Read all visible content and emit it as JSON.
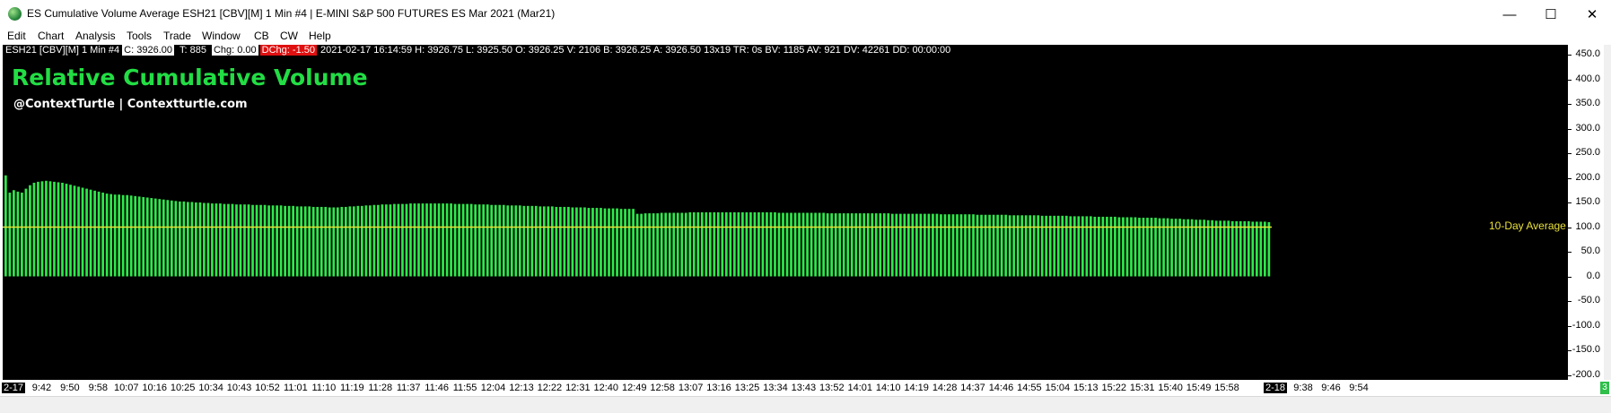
{
  "window": {
    "title": "ES Cumulative Volume Average ESH21 [CBV][M]  1 Min   #4 | E-MINI S&P 500 FUTURES ES Mar 2021 (Mar21)",
    "minimize_glyph": "—",
    "maximize_glyph": "☐",
    "close_glyph": "✕",
    "icon": "globe-icon"
  },
  "menu": [
    "Edit",
    "Chart",
    "Analysis",
    "Tools",
    "Trade",
    "Window",
    "CB",
    "CW",
    "Help"
  ],
  "info_bar": {
    "symbol": "ESH21 [CBV][M]  1 Min   #4",
    "close": "C: 3926.00",
    "ticks": "T: 885",
    "chg": "Chg: 0.00",
    "dchg": "DChg: -1.50",
    "rest": "2021-02-17 16:14:59 H: 3926.75 L: 3925.50 O: 3926.25 V: 2106 B: 3926.25 A: 3926.50 13x19 TR: 0s BV: 1185 AV: 921 DV: 42261 DD: 00:00:00"
  },
  "chart": {
    "title": "Relative Cumulative Volume",
    "subtitle": "@ContextTurtle | Contextturtle.com",
    "average_label": "10-Day Average",
    "colors": {
      "background": "#000000",
      "bars": "#2ee84a",
      "average_line": "#e8e03a",
      "title": "#22dd44",
      "dchg_bg": "#e01010"
    }
  },
  "chart_data": {
    "type": "bar",
    "title": "Relative Cumulative Volume",
    "y_ticks": [
      "450.0",
      "400.0",
      "350.0",
      "300.0",
      "250.0",
      "200.0",
      "150.0",
      "100.0",
      "50.0",
      "0.0",
      "-50.0",
      "-100.0",
      "-150.0",
      "-200.0"
    ],
    "ylim": [
      -210,
      470
    ],
    "x_labels": [
      "2-17",
      "9:42",
      "9:50",
      "9:58",
      "10:07",
      "10:16",
      "10:25",
      "10:34",
      "10:43",
      "10:52",
      "11:01",
      "11:10",
      "11:19",
      "11:28",
      "11:37",
      "11:46",
      "11:55",
      "12:04",
      "12:13",
      "12:22",
      "12:31",
      "12:40",
      "12:49",
      "12:58",
      "13:07",
      "13:16",
      "13:25",
      "13:34",
      "13:43",
      "13:52",
      "14:01",
      "14:10",
      "14:19",
      "14:28",
      "14:37",
      "14:46",
      "14:55",
      "15:04",
      "15:13",
      "15:22",
      "15:31",
      "15:40",
      "15:49",
      "15:58",
      "2-18",
      "9:38",
      "9:46",
      "9:54"
    ],
    "x_labels_highlighted": [
      "2-17",
      "2-18"
    ],
    "series": [
      {
        "name": "Relative Cumulative Volume",
        "values": [
          205,
          170,
          175,
          172,
          170,
          178,
          185,
          190,
          192,
          193,
          194,
          193,
          192,
          191,
          190,
          188,
          186,
          184,
          182,
          180,
          178,
          176,
          174,
          172,
          170,
          168,
          167,
          166,
          166,
          165,
          165,
          164,
          163,
          162,
          161,
          160,
          159,
          158,
          157,
          156,
          155,
          154,
          153,
          152,
          152,
          151,
          151,
          150,
          150,
          149,
          149,
          148,
          148,
          148,
          147,
          147,
          147,
          146,
          146,
          146,
          146,
          145,
          145,
          145,
          145,
          144,
          144,
          144,
          144,
          143,
          143,
          143,
          142,
          142,
          142,
          142,
          141,
          141,
          141,
          141,
          140,
          140,
          140,
          141,
          141,
          142,
          142,
          143,
          143,
          144,
          144,
          145,
          145,
          146,
          146,
          146,
          147,
          147,
          147,
          147,
          148,
          148,
          148,
          148,
          148,
          148,
          148,
          148,
          148,
          148,
          148,
          147,
          147,
          147,
          147,
          147,
          146,
          146,
          146,
          146,
          145,
          145,
          145,
          145,
          144,
          144,
          144,
          144,
          143,
          143,
          143,
          143,
          142,
          142,
          142,
          142,
          141,
          141,
          141,
          141,
          140,
          140,
          140,
          140,
          139,
          139,
          139,
          139,
          138,
          138,
          138,
          138,
          137,
          137,
          137,
          137,
          127,
          127,
          128,
          128,
          128,
          128,
          129,
          129,
          129,
          129,
          129,
          129,
          129,
          130,
          130,
          130,
          130,
          130,
          130,
          130,
          130,
          130,
          130,
          130,
          130,
          130,
          130,
          130,
          130,
          130,
          130,
          130,
          130,
          130,
          130,
          129,
          129,
          129,
          129,
          129,
          129,
          129,
          129,
          129,
          129,
          129,
          129,
          128,
          128,
          128,
          128,
          128,
          128,
          128,
          128,
          128,
          128,
          128,
          128,
          128,
          128,
          128,
          128,
          127,
          127,
          127,
          127,
          127,
          127,
          127,
          127,
          127,
          127,
          127,
          127,
          126,
          126,
          126,
          126,
          126,
          126,
          126,
          126,
          126,
          125,
          125,
          125,
          125,
          125,
          125,
          125,
          125,
          124,
          124,
          124,
          124,
          124,
          124,
          124,
          124,
          123,
          123,
          123,
          123,
          123,
          123,
          123,
          122,
          122,
          122,
          122,
          122,
          122,
          121,
          121,
          121,
          121,
          121,
          121,
          120,
          120,
          120,
          120,
          120,
          119,
          119,
          119,
          119,
          119,
          118,
          118,
          118,
          117,
          117,
          117,
          116,
          116,
          116,
          115,
          115,
          115,
          114,
          114,
          113,
          113,
          113,
          113,
          112,
          112,
          112,
          112,
          112,
          111,
          111,
          111,
          111,
          110
        ]
      },
      {
        "name": "10-Day Average",
        "value": 100
      }
    ],
    "grid": false
  }
}
